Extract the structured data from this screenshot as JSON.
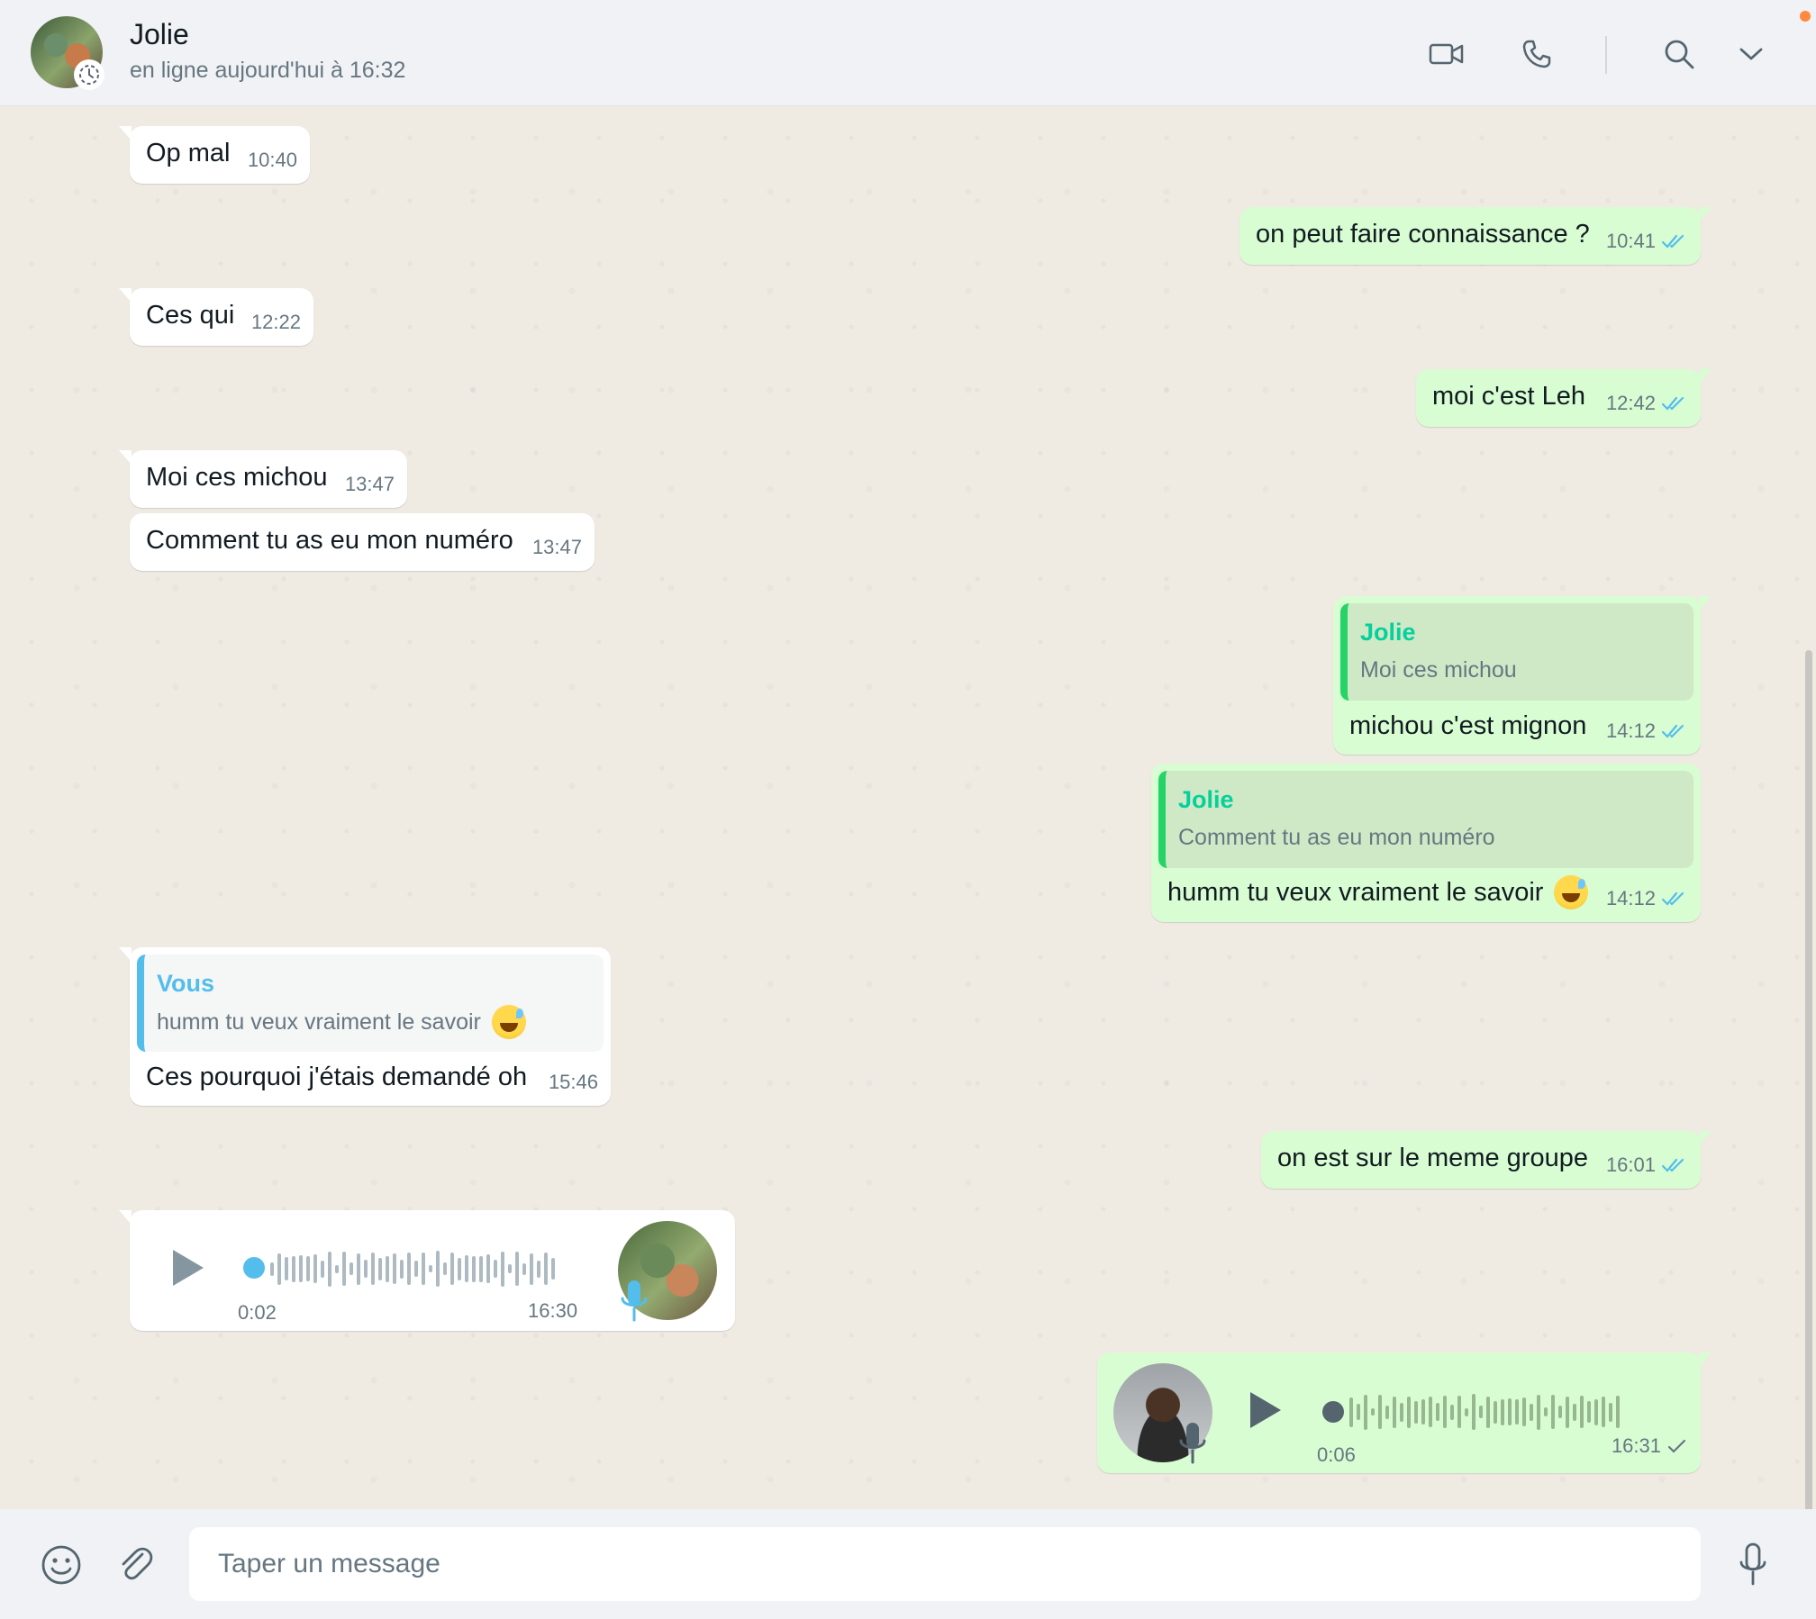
{
  "header": {
    "contact_name": "Jolie",
    "contact_status": "en ligne aujourd'hui à 16:32",
    "icons": [
      "avatar",
      "status-clock-icon",
      "video-call-icon",
      "phone-icon",
      "search-icon",
      "chevron-down-icon"
    ]
  },
  "messages": [
    {
      "direction": "in",
      "text": "Op mal",
      "time": "10:40"
    },
    {
      "direction": "out",
      "text": "on peut faire connaissance ?",
      "time": "10:41",
      "ticks": "read"
    },
    {
      "direction": "in",
      "text": "Ces qui",
      "time": "12:22"
    },
    {
      "direction": "out",
      "text": "moi c'est Leh",
      "time": "12:42",
      "ticks": "read"
    },
    {
      "direction": "in",
      "text": "Moi ces michou",
      "time": "13:47"
    },
    {
      "direction": "in",
      "text": "Comment tu as eu mon numéro",
      "time": "13:47"
    },
    {
      "direction": "out",
      "quote_author": "Jolie",
      "quote_text": "Moi ces michou",
      "text": "michou c'est mignon",
      "time": "14:12",
      "ticks": "read"
    },
    {
      "direction": "out",
      "quote_author": "Jolie",
      "quote_text": "Comment tu as eu mon numéro",
      "text": "humm tu veux vraiment le savoir",
      "time": "14:12",
      "ticks": "read"
    },
    {
      "direction": "in",
      "quote_author": "Vous",
      "quote_text": "humm tu veux vraiment le savoir",
      "text": "Ces pourquoi j'étais demandé oh",
      "time": "15:46"
    },
    {
      "direction": "out",
      "text": "on est sur le meme groupe",
      "time": "16:01",
      "ticks": "read"
    },
    {
      "direction": "in",
      "type": "voice",
      "duration": "0:02",
      "time": "16:30",
      "progress": 0
    },
    {
      "direction": "out",
      "type": "voice",
      "duration": "0:06",
      "time": "16:31",
      "ticks": "sent",
      "progress": 0
    }
  ],
  "composer": {
    "placeholder": "Taper un message",
    "icons": [
      "emoji-icon",
      "attach-icon",
      "microphone-icon"
    ]
  },
  "colors": {
    "incoming": "#ffffff",
    "outgoing": "#d9fdd3",
    "read_ticks": "#53bdeb",
    "quote_author": "#06cf9c",
    "background": "#efeae2"
  }
}
